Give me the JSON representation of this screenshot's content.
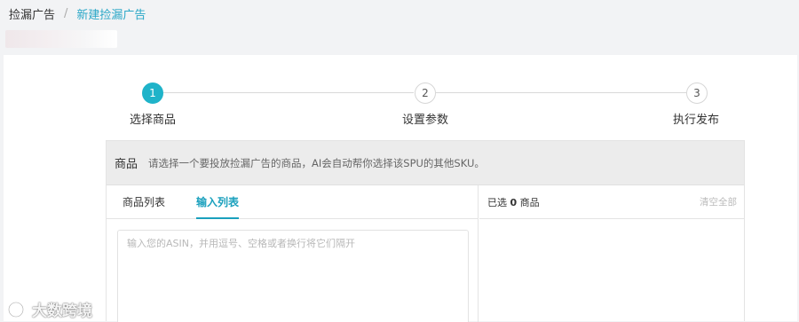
{
  "breadcrumb": {
    "root": "捡漏广告",
    "separator": "/",
    "current": "新建捡漏广告"
  },
  "stepper": {
    "steps": [
      {
        "number": "1",
        "label": "选择商品",
        "active": true
      },
      {
        "number": "2",
        "label": "设置参数",
        "active": false
      },
      {
        "number": "3",
        "label": "执行发布",
        "active": false
      }
    ]
  },
  "product": {
    "title": "商品",
    "hint": "请选择一个要投放捡漏广告的商品，AI会自动帮你选择该SPU的其他SKU。",
    "tabs": [
      {
        "label": "商品列表",
        "active": false
      },
      {
        "label": "输入列表",
        "active": true
      }
    ],
    "asin_input": {
      "placeholder": "输入您的ASIN，并用逗号、空格或者换行将它们隔开",
      "value": ""
    },
    "selected": {
      "prefix": "已选",
      "count": "0",
      "suffix": "商品"
    },
    "clear_all": "清空全部"
  },
  "watermark": {
    "text": "大数跨境"
  },
  "colors": {
    "accent": "#1fb3c9",
    "tab_active": "#1aa0bd",
    "breadcrumb_link": "#2aa7c7",
    "page_bg": "#f2f3f5",
    "header_bg": "#ececec"
  }
}
